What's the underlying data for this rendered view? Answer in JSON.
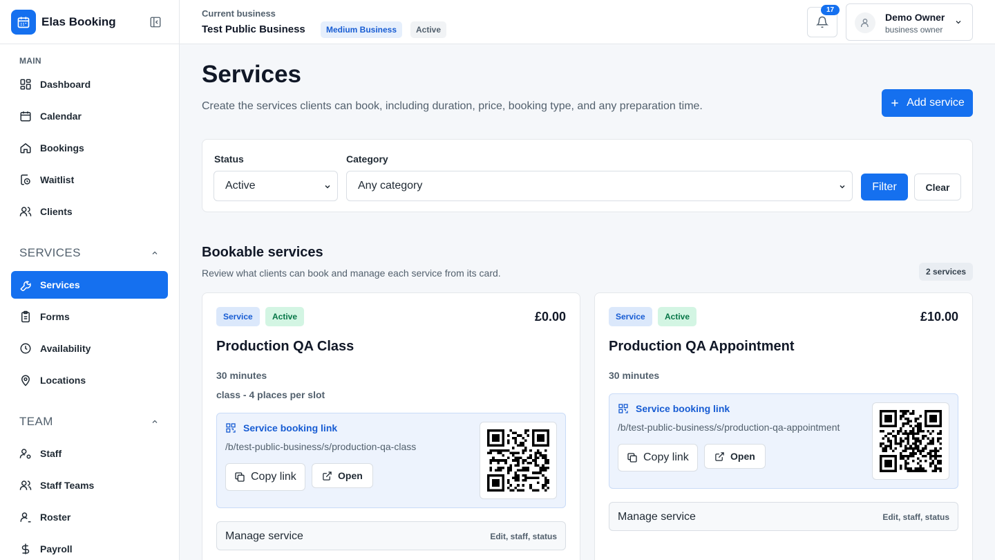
{
  "app": {
    "name": "Elas Booking"
  },
  "sidebar": {
    "main_label": "MAIN",
    "main_items": [
      {
        "label": "Dashboard",
        "icon": "dashboard-icon"
      },
      {
        "label": "Calendar",
        "icon": "calendar-icon"
      },
      {
        "label": "Bookings",
        "icon": "home-icon"
      },
      {
        "label": "Waitlist",
        "icon": "waitlist-icon"
      },
      {
        "label": "Clients",
        "icon": "users-icon"
      }
    ],
    "services_label": "SERVICES",
    "services_items": [
      {
        "label": "Services",
        "icon": "wrench-icon",
        "active": true
      },
      {
        "label": "Forms",
        "icon": "clipboard-icon"
      },
      {
        "label": "Availability",
        "icon": "clock-icon"
      },
      {
        "label": "Locations",
        "icon": "map-pin-icon"
      }
    ],
    "team_label": "TEAM",
    "team_items": [
      {
        "label": "Staff",
        "icon": "user-cog-icon"
      },
      {
        "label": "Staff Teams",
        "icon": "users-icon"
      },
      {
        "label": "Roster",
        "icon": "user-icon"
      },
      {
        "label": "Payroll",
        "icon": "dollar-icon"
      }
    ]
  },
  "header": {
    "current_label": "Current business",
    "business_name": "Test Public Business",
    "plan_badge": "Medium Business",
    "status_badge": "Active",
    "notification_count": "17",
    "user_name": "Demo Owner",
    "user_role": "business owner"
  },
  "page": {
    "title": "Services",
    "subtitle": "Create the services clients can book, including duration, price, booking type, and any preparation time.",
    "add_button": "Add service"
  },
  "filters": {
    "status_label": "Status",
    "status_value": "Active",
    "category_label": "Category",
    "category_value": "Any category",
    "filter_button": "Filter",
    "clear_button": "Clear"
  },
  "section": {
    "title": "Bookable services",
    "subtitle": "Review what clients can book and manage each service from its card.",
    "count": "2 services"
  },
  "services": [
    {
      "type_tag": "Service",
      "status_tag": "Active",
      "price": "£0.00",
      "name": "Production QA Class",
      "duration": "30 minutes",
      "capacity": "class - 4 places per slot",
      "link_title": "Service booking link",
      "link_url": "/b/test-public-business/s/production-qa-class",
      "copy_label": "Copy link",
      "open_label": "Open",
      "manage_label": "Manage service",
      "manage_hint": "Edit, staff, status"
    },
    {
      "type_tag": "Service",
      "status_tag": "Active",
      "price": "£10.00",
      "name": "Production QA Appointment",
      "duration": "30 minutes",
      "link_title": "Service booking link",
      "link_url": "/b/test-public-business/s/production-qa-appointment",
      "copy_label": "Copy link",
      "open_label": "Open",
      "manage_label": "Manage service",
      "manage_hint": "Edit, staff, status"
    }
  ],
  "colors": {
    "accent": "#1570ef",
    "tag_service_bg": "#dbe8fb",
    "tag_active_bg": "#d3f5e3",
    "tag_active_text": "#067647"
  }
}
